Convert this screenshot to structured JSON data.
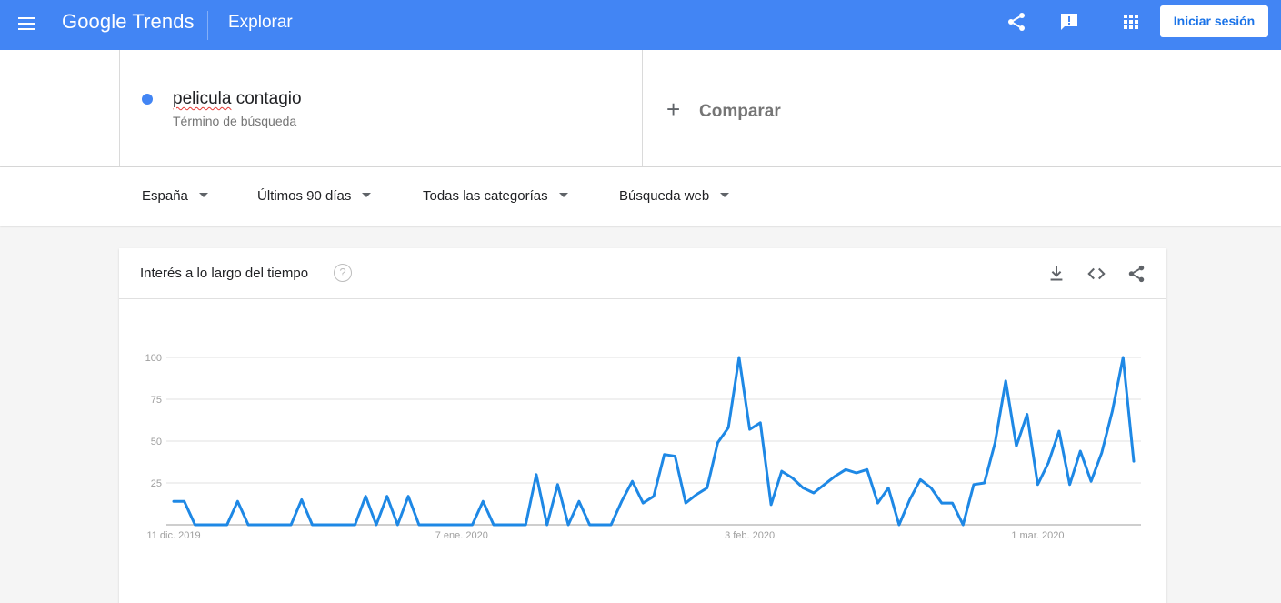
{
  "header": {
    "logo_google": "Google",
    "logo_trends": "Trends",
    "section": "Explorar",
    "signin_label": "Iniciar sesión",
    "accent": "#4285f4"
  },
  "term": {
    "name_spell": "pelicula",
    "name_rest": " contagio",
    "type": "Término de búsqueda",
    "color": "#4285f4"
  },
  "compare": {
    "label": "Comparar"
  },
  "filters": [
    {
      "label": "España"
    },
    {
      "label": "Últimos 90 días"
    },
    {
      "label": "Todas las categorías"
    },
    {
      "label": "Búsqueda web"
    }
  ],
  "card": {
    "title": "Interés a lo largo del tiempo",
    "help": "?"
  },
  "chart_data": {
    "type": "line",
    "title": "Interés a lo largo del tiempo",
    "y_ticks": [
      25,
      50,
      75,
      100
    ],
    "ylim": [
      0,
      100
    ],
    "x_tick_labels": [
      "11 dic. 2019",
      "7 ene. 2020",
      "3 feb. 2020",
      "1 mar. 2020"
    ],
    "x_tick_index": [
      0,
      27,
      54,
      81
    ],
    "grid": true,
    "series": [
      {
        "color": "#1e88e5",
        "values": [
          14,
          14,
          0,
          0,
          0,
          0,
          14,
          0,
          0,
          0,
          0,
          0,
          15,
          0,
          0,
          0,
          0,
          0,
          17,
          0,
          17,
          0,
          17,
          0,
          0,
          0,
          0,
          0,
          0,
          14,
          0,
          0,
          0,
          0,
          30,
          0,
          24,
          0,
          14,
          0,
          0,
          0,
          14,
          26,
          13,
          17,
          42,
          41,
          13,
          18,
          22,
          49,
          58,
          100,
          57,
          61,
          12,
          32,
          28,
          22,
          19,
          24,
          29,
          33,
          31,
          33,
          13,
          22,
          0,
          15,
          27,
          22,
          13,
          13,
          0,
          24,
          25,
          49,
          86,
          47,
          66,
          24,
          37,
          56,
          24,
          44,
          26,
          43,
          68,
          100,
          38
        ]
      }
    ]
  }
}
